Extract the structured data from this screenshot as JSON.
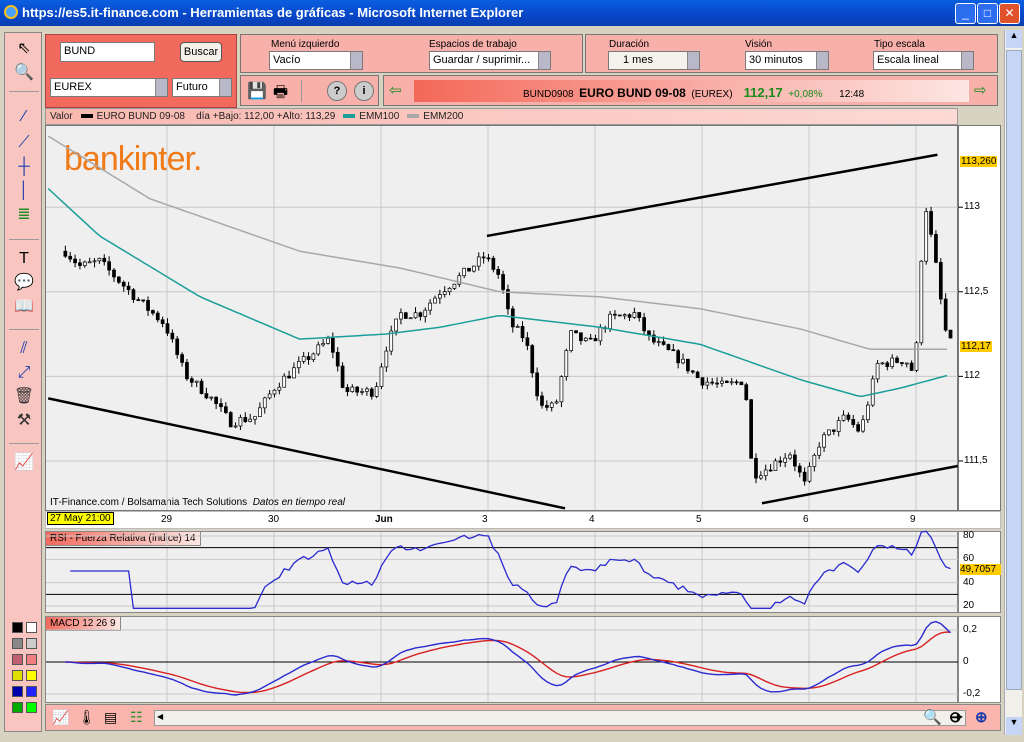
{
  "window": {
    "title": "https://es5.it-finance.com - Herramientas de gráficas - Microsoft Internet Explorer",
    "minimize": "_",
    "maximize": "□",
    "close": "✕"
  },
  "search": {
    "value": "BUND",
    "button": "Buscar",
    "market": "EUREX",
    "type": "Futuro"
  },
  "menus": {
    "left_label": "Menú izquierdo",
    "left_value": "Vacío",
    "work_label": "Espacios de trabajo",
    "work_value": "Guardar / suprimir...",
    "dur_label": "Duración",
    "dur_value": "1 mes",
    "vis_label": "Visión",
    "vis_value": "30 minutos",
    "scale_label": "Tipo escala",
    "scale_value": "Escala lineal"
  },
  "ticker": {
    "code": "BUND0908",
    "name": "EURO BUND 09-08",
    "exchange": "(EUREX)",
    "price": "112,17",
    "change": "+0,08%",
    "time": "12:48",
    "price_color": "#1a8a1a"
  },
  "legend": {
    "valor": "Valor",
    "series": "EURO BUND 09-08",
    "range": "día +Bajo: 112,00 +Alto: 113,29",
    "emm100": "EMM100",
    "emm200": "EMM200"
  },
  "colors": {
    "price": "#000000",
    "emm100": "#1a9e9a",
    "emm200": "#a8a8a8",
    "rsi": "#2a2ad0",
    "macd": "#2a2ad0",
    "signal": "#d82020",
    "highlight": "#ffcc00"
  },
  "brand": "bankinter.",
  "credits": {
    "source": "IT-Finance.com / Bolsamania Tech Solutions",
    "realtime": "Datos en tiempo real"
  },
  "price_axis": {
    "ticks": [
      {
        "v": 113,
        "label": "113"
      },
      {
        "v": 112.5,
        "label": "112,5"
      },
      {
        "v": 112,
        "label": "112"
      },
      {
        "v": 111.5,
        "label": "111,5"
      }
    ],
    "ylim": [
      111.21,
      113.48
    ],
    "high_label": "113,260",
    "high": 113.26,
    "last_label": "112,17",
    "last": 112.17
  },
  "date_axis": {
    "start": "27 May 21:00",
    "days": [
      {
        "t": 1,
        "label": "29"
      },
      {
        "t": 2,
        "label": "30"
      },
      {
        "t": 3,
        "label": "Jun"
      },
      {
        "t": 4,
        "label": "3"
      },
      {
        "t": 5,
        "label": "4"
      },
      {
        "t": 6,
        "label": "5"
      },
      {
        "t": 7,
        "label": "6"
      },
      {
        "t": 8,
        "label": "9"
      }
    ]
  },
  "price_path": [
    [
      0.05,
      112.74
    ],
    [
      0.19,
      112.65
    ],
    [
      0.37,
      112.68
    ],
    [
      0.56,
      112.56
    ],
    [
      0.75,
      112.44
    ],
    [
      0.98,
      112.31
    ],
    [
      1.17,
      112.01
    ],
    [
      1.4,
      111.88
    ],
    [
      1.59,
      111.73
    ],
    [
      1.82,
      111.76
    ],
    [
      2.01,
      111.94
    ],
    [
      2.24,
      112.07
    ],
    [
      2.52,
      112.22
    ],
    [
      2.66,
      111.91
    ],
    [
      2.94,
      111.91
    ],
    [
      3.04,
      112.16
    ],
    [
      3.18,
      112.37
    ],
    [
      3.36,
      112.37
    ],
    [
      3.55,
      112.5
    ],
    [
      3.74,
      112.59
    ],
    [
      3.97,
      112.71
    ],
    [
      4.11,
      112.59
    ],
    [
      4.21,
      112.31
    ],
    [
      4.35,
      112.22
    ],
    [
      4.49,
      111.82
    ],
    [
      4.63,
      111.82
    ],
    [
      4.77,
      112.25
    ],
    [
      4.95,
      112.19
    ],
    [
      5.14,
      112.34
    ],
    [
      5.37,
      112.37
    ],
    [
      5.51,
      112.22
    ],
    [
      5.79,
      112.1
    ],
    [
      5.98,
      111.98
    ],
    [
      6.21,
      111.94
    ],
    [
      6.4,
      111.98
    ],
    [
      6.47,
      111.42
    ],
    [
      6.59,
      111.45
    ],
    [
      6.82,
      111.55
    ],
    [
      6.96,
      111.36
    ],
    [
      7.1,
      111.61
    ],
    [
      7.34,
      111.76
    ],
    [
      7.48,
      111.67
    ],
    [
      7.64,
      112.07
    ],
    [
      7.9,
      112.1
    ],
    [
      7.99,
      112.01
    ],
    [
      8.08,
      113.05
    ],
    [
      8.18,
      112.68
    ],
    [
      8.27,
      112.28
    ],
    [
      8.34,
      112.17
    ]
  ],
  "emm100_path": [
    [
      -0.11,
      113.11
    ],
    [
      0.37,
      112.83
    ],
    [
      1.31,
      112.47
    ],
    [
      2.24,
      112.22
    ],
    [
      3.04,
      112.25
    ],
    [
      3.55,
      112.29
    ],
    [
      4.11,
      112.36
    ],
    [
      5.05,
      112.29
    ],
    [
      5.98,
      112.19
    ],
    [
      6.92,
      111.98
    ],
    [
      7.48,
      111.88
    ],
    [
      7.85,
      111.93
    ],
    [
      8.32,
      112.01
    ]
  ],
  "emm200_path": [
    [
      -0.11,
      113.42
    ],
    [
      0.84,
      113.05
    ],
    [
      2.24,
      112.74
    ],
    [
      3.18,
      112.64
    ],
    [
      4.11,
      112.5
    ],
    [
      5.05,
      112.47
    ],
    [
      5.98,
      112.4
    ],
    [
      6.92,
      112.28
    ],
    [
      7.57,
      112.16
    ],
    [
      8.32,
      112.16
    ]
  ],
  "trendlines": [
    [
      [
        3.99,
        112.83
      ],
      [
        8.2,
        113.31
      ]
    ],
    [
      [
        -0.11,
        111.87
      ],
      [
        4.72,
        111.22
      ]
    ],
    [
      [
        6.56,
        111.25
      ],
      [
        8.39,
        111.47
      ]
    ]
  ],
  "rsi": {
    "title": "RSI - Fuerza Relativa (índice) 14",
    "ticks": [
      {
        "v": 80,
        "label": "80"
      },
      {
        "v": 60,
        "label": "60"
      },
      {
        "v": 40,
        "label": "40"
      },
      {
        "v": 20,
        "label": "20"
      }
    ],
    "last_label": "49,7057"
  },
  "macd": {
    "title": "MACD 12 26 9",
    "ticks": [
      {
        "v": 0.2,
        "label": "0,2"
      },
      {
        "v": 0,
        "label": "0"
      },
      {
        "v": -0.2,
        "label": "-0,2"
      }
    ]
  }
}
